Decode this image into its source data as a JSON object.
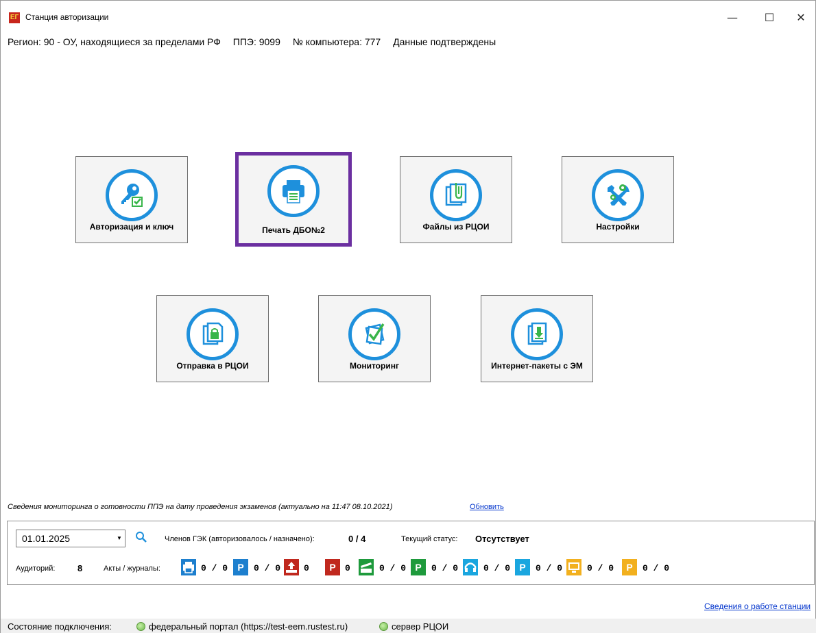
{
  "window": {
    "title": "Станция авторизации",
    "app_icon_text": "ЕГ",
    "minimize": "—",
    "maximize": "☐",
    "close": "✕"
  },
  "infobar": {
    "region": "Регион: 90 - ОУ, находящиеся за пределами РФ",
    "ppe": "ППЭ: 9099",
    "computer": "№ компьютера: 777",
    "status": "Данные подтверждены"
  },
  "tiles": [
    {
      "label": "Авторизация и ключ",
      "icon": "key-check-icon"
    },
    {
      "label": "Печать ДБО№2",
      "icon": "printer-icon",
      "selected": true
    },
    {
      "label": "Файлы из РЦОИ",
      "icon": "files-clip-icon"
    },
    {
      "label": "Настройки",
      "icon": "wrench-gears-icon"
    },
    {
      "label": "Отправка в РЦОИ",
      "icon": "lock-documents-icon"
    },
    {
      "label": "Мониторинг",
      "icon": "checklist-icon"
    },
    {
      "label": "Интернет-пакеты с ЭМ",
      "icon": "download-documents-icon"
    }
  ],
  "monitoring": {
    "caption": "Сведения мониторинга о готовности ППЭ на дату проведения экзаменов (актуально на 11:47 08.10.2021)",
    "refresh": "Обновить",
    "date": "01.01.2025",
    "gek_label": "Членов ГЭК (авторизовалось / назначено):",
    "gek_value": "0 / 4",
    "status_label": "Текущий статус:",
    "status_value": "Отсутствует",
    "auditorium_label": "Аудиторий:",
    "auditorium_value": "8",
    "acts_label": "Акты / журналы:",
    "acts": [
      {
        "badge": "print-icon",
        "color": "#1d7fce",
        "value": "0 / 0"
      },
      {
        "badge": "P",
        "color": "#1d7fce",
        "value": "0 / 0"
      },
      {
        "badge": "upload-icon",
        "color": "#c0281e",
        "value": "0"
      },
      {
        "badge": "P",
        "color": "#c0281e",
        "value": "0"
      },
      {
        "badge": "scanner-icon",
        "color": "#1e9a3c",
        "value": "0 / 0"
      },
      {
        "badge": "P",
        "color": "#1e9a3c",
        "value": "0 / 0"
      },
      {
        "badge": "headset-icon",
        "color": "#1aa6df",
        "value": "0 / 0"
      },
      {
        "badge": "P",
        "color": "#1aa6df",
        "value": "0 / 0"
      },
      {
        "badge": "monitor-icon",
        "color": "#f2b01e",
        "value": "0 / 0"
      },
      {
        "badge": "P",
        "color": "#f2b01e",
        "value": "0 / 0"
      }
    ]
  },
  "station_link": "Сведения о работе станции",
  "statusbar": {
    "label": "Состояние подключения:",
    "federal": "федеральный портал (https://test-eem.rustest.ru)",
    "rcoi": "сервер РЦОИ"
  }
}
